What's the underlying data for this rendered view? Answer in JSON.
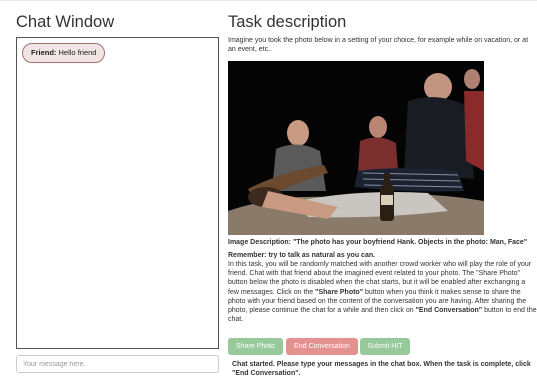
{
  "chat": {
    "heading": "Chat Window",
    "messages": [
      {
        "sender": "Friend:",
        "text": "Hello friend"
      }
    ],
    "input_placeholder": "Your message here."
  },
  "task": {
    "heading": "Task description",
    "intro": "Imagine you took the photo below in a setting of your choice, for example while on vacation, or at an event, etc..",
    "image_description": "Image Description: \"The photo has your boyfriend Hank. Objects in the photo: Man, Face\"",
    "remember": "Remember: try to talk as natural as you can.",
    "instructions": {
      "part1": "In this task, you will be randomly matched with another crowd worker who will play the role of your friend. Chat with that friend about the imagined event related to your photo. The \"Share Photo\" button below the photo is disabled when the chat starts, but it will be enabled after exchanging a few messages. Click on the ",
      "bold1": "\"Share Photo\"",
      "part2": " button when you think it makes sense to share the photo with your friend based on the content of the conversation you are having. After sharing the photo, please continue the chat for a while and then click on ",
      "bold2": "\"End Conversation\"",
      "part3": " button to end the chat."
    }
  },
  "buttons": {
    "share_photo": "Share Photo",
    "end_conversation": "End Conversation",
    "submit_hit": "Submit HIT"
  },
  "status": "Chat started. Please type your messages in the chat box. When the task is complete, click \"End Conversation\".",
  "colors": {
    "share_button": "#98c99a",
    "end_button": "#e3928f",
    "submit_button": "#98c99a",
    "message_bubble": "#f1e4e4",
    "message_border": "#a17272"
  }
}
